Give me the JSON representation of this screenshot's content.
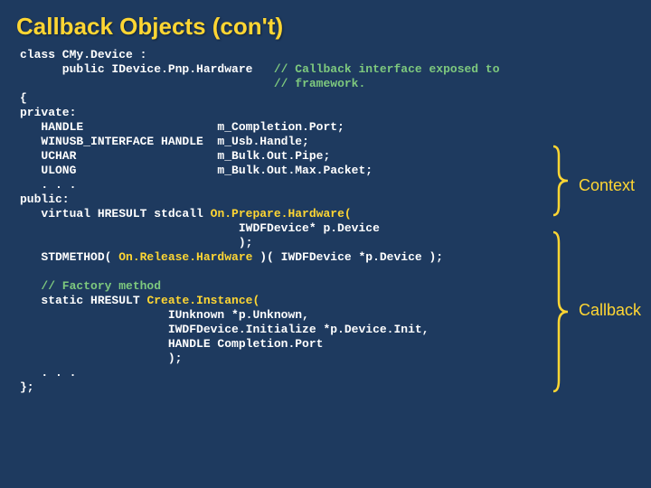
{
  "title": "Callback Objects (con't)",
  "code": {
    "l1": "class CMy.Device :",
    "l2": "      public IDevice.Pnp.Hardware   ",
    "c2": "// Callback interface exposed to",
    "l3": "                                    ",
    "c3": "// framework.",
    "l4": "{",
    "l5": "private:",
    "l6": "   HANDLE                   m_Completion.Port;",
    "l7": "   WINUSB_INTERFACE HANDLE  m_Usb.Handle;",
    "l8": "   UCHAR                    m_Bulk.Out.Pipe;",
    "l9": "   ULONG                    m_Bulk.Out.Max.Packet;",
    "l10": "   . . .",
    "l11": "public:",
    "l12": "   virtual HRESULT stdcall ",
    "m12": "On.Prepare.Hardware(",
    "l13": "                               IWDFDevice* p.Device",
    "l14": "                               );",
    "l15": "   STDMETHOD( ",
    "m15": "On.Release.Hardware ",
    "l15b": ")( IWDFDevice *p.Device );",
    "l16": "",
    "l17": "   ",
    "c17": "// Factory method",
    "l18": "   static HRESULT ",
    "m18": "Create.Instance(",
    "l19": "                     IUnknown *p.Unknown,",
    "l20": "                     IWDFDevice.Initialize *p.Device.Init,",
    "l21": "                     HANDLE Completion.Port",
    "l22": "                     );",
    "l23": "   . . .",
    "l24": "};"
  },
  "labels": {
    "context": "Context",
    "callback": "Callback"
  }
}
